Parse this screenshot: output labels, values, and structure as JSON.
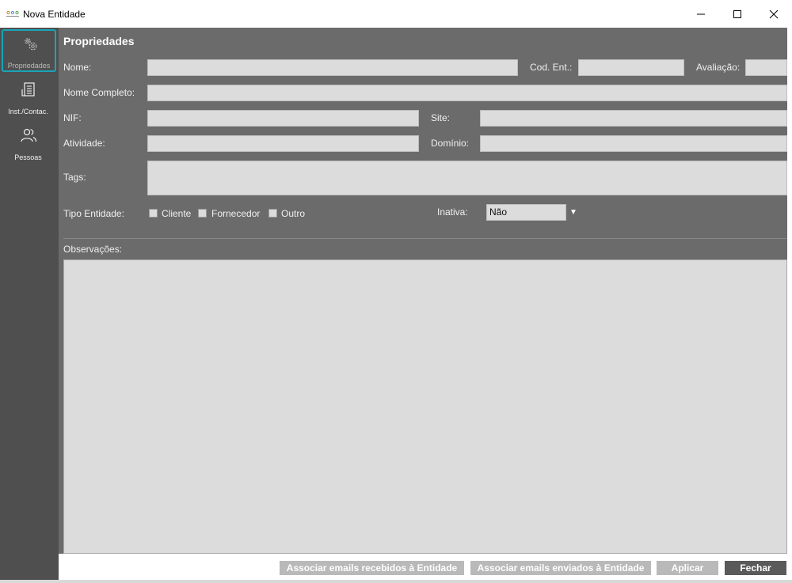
{
  "window": {
    "title": "Nova Entidade"
  },
  "sidebar": {
    "items": [
      {
        "label": "Propriedades",
        "icon": "gear-icon",
        "active": true
      },
      {
        "label": "Inst./Contac.",
        "icon": "building-contact-icon",
        "active": false
      },
      {
        "label": "Pessoas",
        "icon": "people-icon",
        "active": false
      }
    ]
  },
  "main": {
    "heading": "Propriedades",
    "labels": {
      "nome": "Nome:",
      "cod_ent": "Cod. Ent.:",
      "avaliacao": "Avaliação:",
      "nome_completo": "Nome Completo:",
      "nif": "NIF:",
      "site": "Site:",
      "atividade": "Atividade:",
      "dominio": "Domínio:",
      "tags": "Tags:",
      "tipo_entidade": "Tipo Entidade:",
      "inativa": "Inativa:",
      "observacoes": "Observações:"
    },
    "checkboxes": [
      "Cliente",
      "Fornecedor",
      "Outro"
    ],
    "inativa_value": "Não"
  },
  "footer": {
    "btn_recebidos": "Associar emails recebidos à Entidade",
    "btn_enviados": "Associar emails enviados à Entidade",
    "btn_aplicar": "Aplicar",
    "btn_fechar": "Fechar"
  },
  "colors": {
    "accent": "#1aa4b8",
    "sidebar_bg": "#4f4f4f",
    "panel_bg": "#6b6b6b",
    "field_bg": "#dcdcdc"
  }
}
